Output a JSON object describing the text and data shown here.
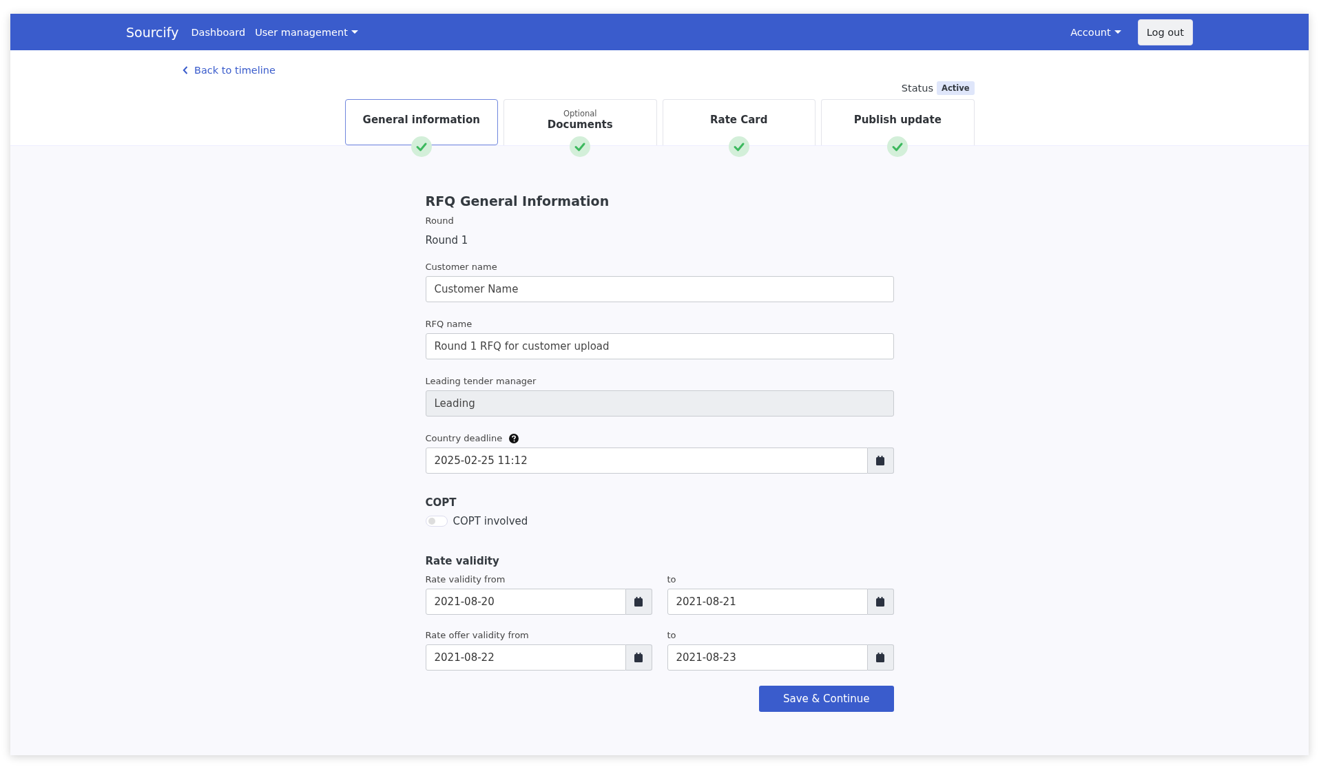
{
  "navbar": {
    "brand": "Sourcify",
    "links": [
      {
        "label": "Dashboard",
        "dropdown": false
      },
      {
        "label": "User management",
        "dropdown": true
      }
    ],
    "account": {
      "label": "Account",
      "dropdown": true
    },
    "logout": "Log out"
  },
  "back_link": "Back to timeline",
  "status": {
    "label": "Status",
    "badge": "Active"
  },
  "tabs": [
    {
      "title": "General information",
      "selected": true,
      "done": true
    },
    {
      "subtitle": "Optional",
      "title": "Documents",
      "selected": false,
      "done": true
    },
    {
      "title": "Rate Card",
      "selected": false,
      "done": true
    },
    {
      "title": "Publish update",
      "selected": false,
      "done": true
    }
  ],
  "form": {
    "title": "RFQ General Information",
    "round": {
      "label": "Round",
      "value": "Round 1"
    },
    "fields": [
      {
        "label": "Customer name",
        "value": "Customer Name",
        "disabled": false
      },
      {
        "label": "RFQ name",
        "value": "Round 1 RFQ for customer upload",
        "disabled": false
      },
      {
        "label": "Leading tender manager",
        "value": "Leading",
        "disabled": true
      }
    ],
    "deadline": {
      "label": "Country deadline",
      "value": "2025-02-25 11:12",
      "help": true
    },
    "copt": {
      "heading": "COPT",
      "toggle_label": "COPT involved",
      "on": false
    },
    "rate_validity": {
      "heading": "Rate validity",
      "rows": [
        {
          "from_label": "Rate validity from",
          "from": "2021-08-20",
          "to_label": "to",
          "to": "2021-08-21"
        },
        {
          "from_label": "Rate offer validity from",
          "from": "2021-08-22",
          "to_label": "to",
          "to": "2021-08-23"
        }
      ]
    },
    "submit": "Save & Continue"
  }
}
